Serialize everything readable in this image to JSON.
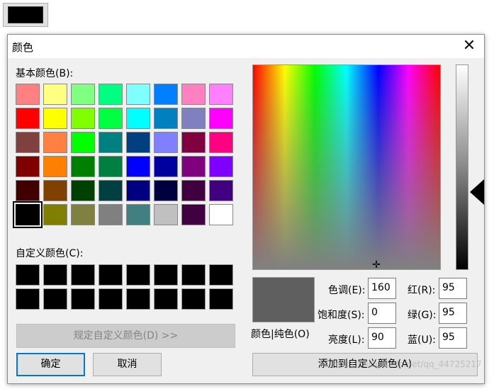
{
  "current_color": "#000000",
  "dialog": {
    "title": "颜色",
    "close_glyph": "✕",
    "basic_colors_label": "基本颜色(B):",
    "basic_colors": [
      [
        "#ff8080",
        "#ffff80",
        "#80ff80",
        "#00ff80",
        "#80ffff",
        "#0080ff",
        "#ff80c0",
        "#ff80ff"
      ],
      [
        "#ff0000",
        "#ffff00",
        "#80ff00",
        "#00ff40",
        "#00ffff",
        "#0080c0",
        "#8080c0",
        "#ff00ff"
      ],
      [
        "#804040",
        "#ff8040",
        "#00ff00",
        "#008080",
        "#004080",
        "#8080ff",
        "#800040",
        "#ff0080"
      ],
      [
        "#800000",
        "#ff8000",
        "#008000",
        "#008040",
        "#0000ff",
        "#0000a0",
        "#800080",
        "#8000ff"
      ],
      [
        "#400000",
        "#804000",
        "#004000",
        "#004040",
        "#000080",
        "#000040",
        "#400040",
        "#400080"
      ],
      [
        "#000000",
        "#808000",
        "#808040",
        "#808080",
        "#408080",
        "#c0c0c0",
        "#400040",
        "#ffffff"
      ]
    ],
    "selected_basic": "5-0",
    "custom_colors_label": "自定义颜色(C):",
    "custom_colors_count": 16,
    "define_custom_button": "规定自定义颜色(D) >>",
    "ok_button": "确定",
    "cancel_button": "取消",
    "color_solid_label": "颜色|纯色(O)",
    "preview_color": "#5f5f5f",
    "hue_label": "色调(E):",
    "hue": "160",
    "sat_label": "饱和度(S):",
    "sat": "0",
    "lum_label": "亮度(L):",
    "lum": "90",
    "red_label": "红(R):",
    "red": "95",
    "green_label": "绿(G):",
    "green": "95",
    "blue_label": "蓝(U):",
    "blue": "95",
    "add_custom_button": "添加到自定义颜色(A)",
    "watermark": "https://blog.csdn.net/qq_44725217"
  }
}
